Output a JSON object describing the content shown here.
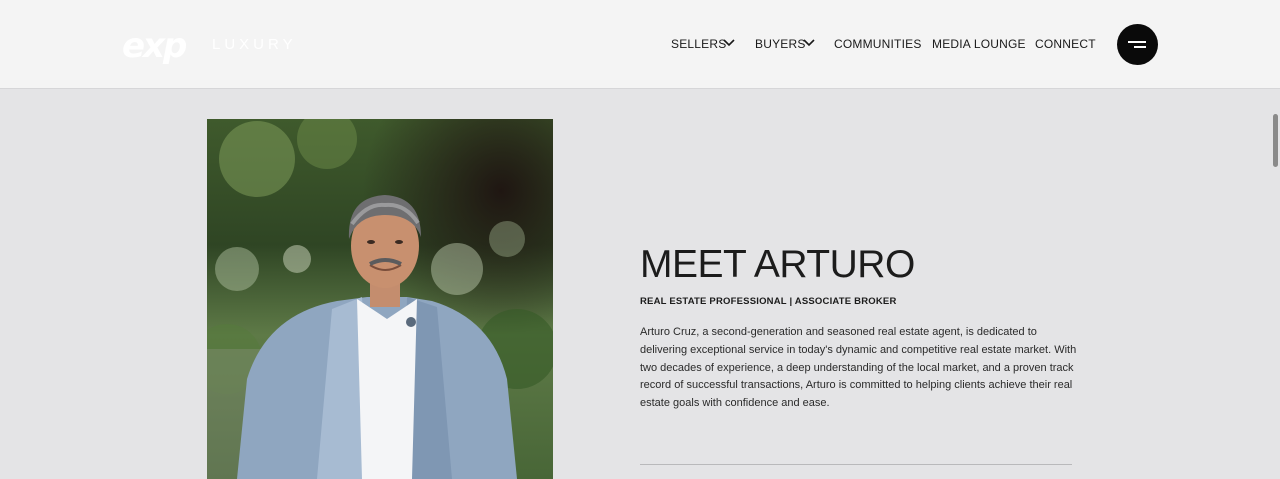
{
  "header": {
    "logo": {
      "brand": "exp",
      "tagline": "LUXURY"
    },
    "nav": [
      {
        "label": "SELLERS",
        "has_dropdown": true
      },
      {
        "label": "BUYERS",
        "has_dropdown": true
      },
      {
        "label": "COMMUNITIES",
        "has_dropdown": false
      },
      {
        "label": "MEDIA LOUNGE",
        "has_dropdown": false
      },
      {
        "label": "CONNECT",
        "has_dropdown": false
      }
    ],
    "menu_icon": "hamburger-menu-icon"
  },
  "profile": {
    "title": "MEET ARTURO",
    "subtitle": "REAL ESTATE PROFESSIONAL | ASSOCIATE BROKER",
    "bio": "Arturo Cruz, a second-generation and seasoned real estate agent, is dedicated to delivering exceptional service in today's dynamic and competitive real estate market. With two decades of experience, a deep understanding of the local market, and a proven track record of successful transactions, Arturo is committed to helping clients achieve their real estate goals with confidence and ease."
  },
  "colors": {
    "header_bg": "#f4f4f4",
    "page_bg": "#e4e4e6",
    "text": "#1c1c1c",
    "menu_button": "#0a0a0a"
  }
}
